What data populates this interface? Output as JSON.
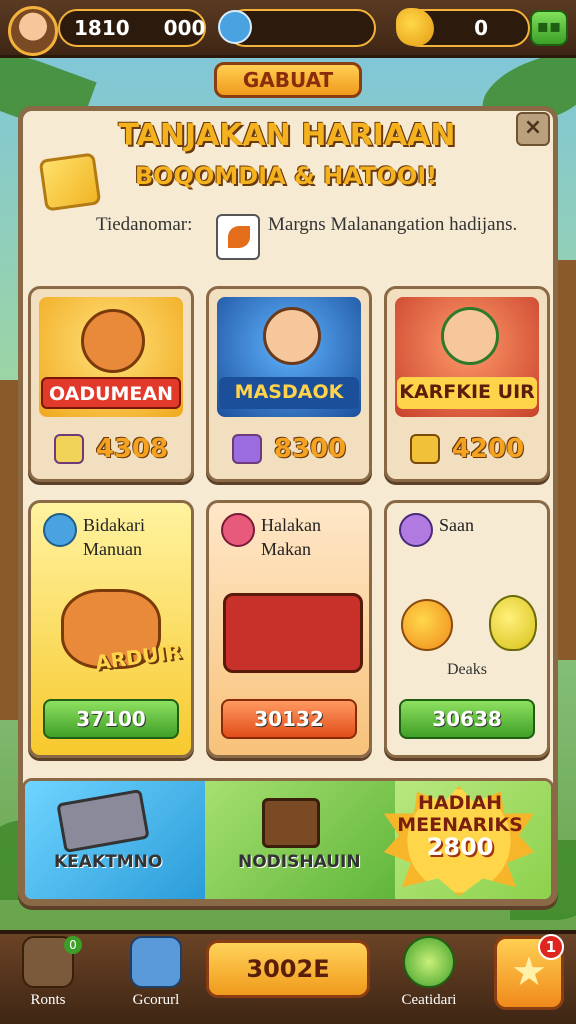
{
  "topbar": {
    "coins": "1810",
    "coins_secondary": "000",
    "bananas": "0"
  },
  "banner": {
    "label": "GABUAT"
  },
  "panel": {
    "title_line1": "TANJAKAN HARIAAN",
    "title_line2": "BOQOMDIA & HATOOI!",
    "desc_left": "Tiedanomar:",
    "desc_right": "Margns Malanangation hadijans.",
    "close": "×"
  },
  "cards_row1": [
    {
      "label": "OADUMEAN",
      "price": "4308"
    },
    {
      "label": "MASDAOK",
      "price": "8300"
    },
    {
      "label": "KARFKIE UIR",
      "price": "4200"
    }
  ],
  "cards_row2": [
    {
      "heading": "Bidakari Manuan",
      "badge": "ARDUIR",
      "button": "37100"
    },
    {
      "heading": "Halakan Makan",
      "badge": "",
      "button": "30132"
    },
    {
      "heading": "Saan",
      "badge": "Deaks",
      "button": "30638"
    }
  ],
  "strip": {
    "left_label": "KEAKTMNO",
    "mid_label": "NODISHAUIN",
    "burst_line1": "HADIAH",
    "burst_line2": "MEENARIKS",
    "burst_num": "2800"
  },
  "nav": {
    "home_label": "Ronts",
    "bus_label": "Gcorurl",
    "center_value": "3002E",
    "swirl_label": "Ceatidari",
    "badge_count": "1",
    "home_badge": "0"
  },
  "colors": {
    "accent": "#f5b21f",
    "panel": "#f6ead3",
    "green": "#3f9f28",
    "orange": "#e24d1a"
  }
}
